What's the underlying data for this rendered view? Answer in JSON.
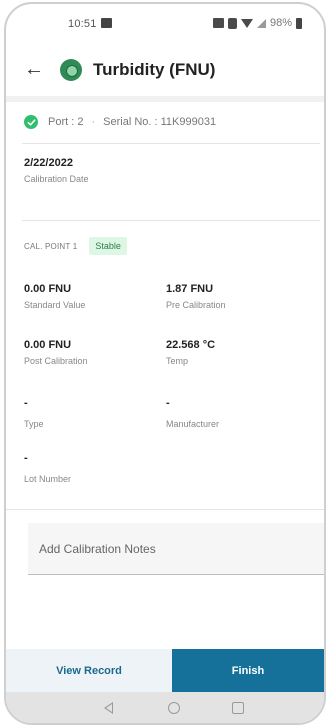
{
  "status_bar": {
    "time": "10:51",
    "battery": "98%",
    "icons": [
      "image-icon",
      "nfc-icon",
      "vibrate-icon",
      "wifi-icon",
      "signal-icon",
      "battery-icon"
    ]
  },
  "header": {
    "back_icon": "back-arrow-icon",
    "sensor_icon": "turbidity-sensor-icon",
    "title": "Turbidity (FNU)"
  },
  "sensor_info": {
    "status_icon": "check-circle-icon",
    "port": "Port : 2",
    "separator": "·",
    "serial": "Serial No. : 11K999031"
  },
  "calibration": {
    "date_value": "2/22/2022",
    "date_label": "Calibration Date",
    "point_label": "CAL. POINT 1",
    "point_status": "Stable",
    "fields": {
      "standard_value": {
        "value": "0.00 FNU",
        "label": "Standard Value"
      },
      "pre_calibration": {
        "value": "1.87 FNU",
        "label": "Pre Calibration"
      },
      "post_calibration": {
        "value": "0.00 FNU",
        "label": "Post Calibration"
      },
      "temp": {
        "value": "22.568 °C",
        "label": "Temp"
      },
      "type": {
        "value": "-",
        "label": "Type"
      },
      "manufacturer": {
        "value": "-",
        "label": "Manufacturer"
      },
      "lot_number": {
        "value": "-",
        "label": "Lot Number"
      }
    }
  },
  "notes": {
    "placeholder": "Add Calibration Notes",
    "value": ""
  },
  "actions": {
    "view_record": "View Record",
    "finish": "Finish"
  },
  "nav_bar": {
    "icons": [
      "nav-back-icon",
      "nav-home-icon",
      "nav-recents-icon"
    ]
  },
  "colors": {
    "primary": "#15719a",
    "success": "#2fbf6f",
    "badge_bg": "#def6e4",
    "badge_text": "#2e7d4b"
  }
}
